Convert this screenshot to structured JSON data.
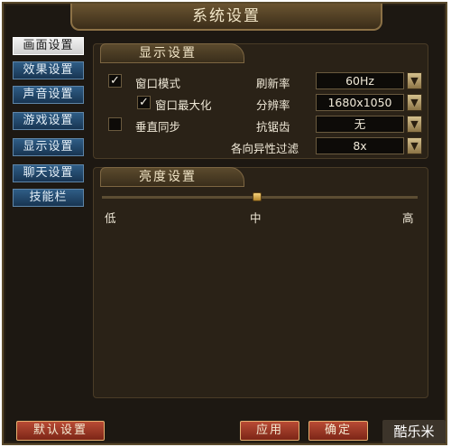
{
  "window": {
    "title": "系统设置"
  },
  "sidebar": {
    "items": [
      {
        "label": "画面设置",
        "active": true
      },
      {
        "label": "效果设置"
      },
      {
        "label": "声音设置"
      },
      {
        "label": "游戏设置"
      },
      {
        "label": "显示设置"
      },
      {
        "label": "聊天设置"
      },
      {
        "label": "技能栏"
      }
    ]
  },
  "display_panel": {
    "title": "显示设置",
    "window_mode": {
      "label": "窗口模式",
      "checked": true
    },
    "window_maximize": {
      "label": "窗口最大化",
      "checked": true
    },
    "vsync": {
      "label": "垂直同步",
      "checked": false
    },
    "refresh_rate": {
      "label": "刷新率",
      "value": "60Hz"
    },
    "resolution": {
      "label": "分辨率",
      "value": "1680x1050"
    },
    "antialias": {
      "label": "抗锯齿",
      "value": "无"
    },
    "anisotropic": {
      "label": "各向异性过滤",
      "value": "8x"
    },
    "check_mark": "✓",
    "arrow_glyph": "▼"
  },
  "brightness_panel": {
    "title": "亮度设置",
    "low": "低",
    "mid": "中",
    "high": "高",
    "level": 0.5
  },
  "footer": {
    "default_label": "默认设置",
    "apply_label": "应用",
    "ok_label": "确定"
  },
  "watermark": "酷乐米",
  "colors": {
    "tab_active": "#e6e6e6",
    "tab_inactive": "#234a6e",
    "button": "#9c3a26",
    "frame": "#5a4a2c"
  }
}
